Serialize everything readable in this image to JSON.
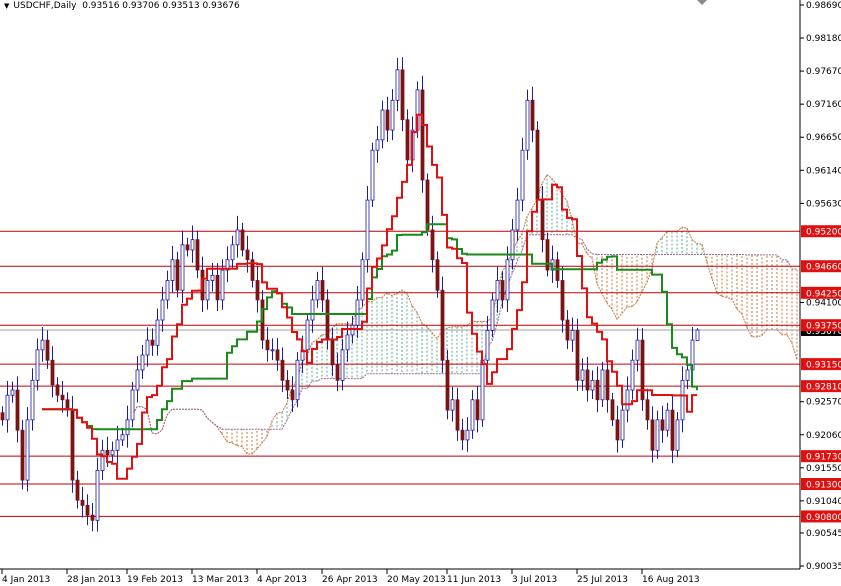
{
  "header": {
    "symbol": "USDCHF,Daily",
    "ohlc_text": "0.93516 0.93706 0.93513 0.93676"
  },
  "chart_data": {
    "type": "candlestick",
    "title": "USDCHF,Daily",
    "ylim": [
      0.90035,
      0.9869
    ],
    "indicator": "Ichimoku Kinko Hyo (9, 26, 52)",
    "first_open": 0.924,
    "last_bar": {
      "open": 0.93516,
      "high": 0.93706,
      "low": 0.93513,
      "close": 0.93676
    },
    "closes": [
      0.9229,
      0.9267,
      0.9275,
      0.9213,
      0.9136,
      0.9229,
      0.929,
      0.9337,
      0.9352,
      0.9321,
      0.9283,
      0.9267,
      0.926,
      0.9244,
      0.9136,
      0.9105,
      0.9097,
      0.9082,
      0.9074,
      0.9151,
      0.9182,
      0.9175,
      0.9182,
      0.9198,
      0.9206,
      0.9229,
      0.9275,
      0.9306,
      0.9329,
      0.9352,
      0.9344,
      0.9383,
      0.9414,
      0.9444,
      0.9476,
      0.9429,
      0.9499,
      0.9491,
      0.9507,
      0.946,
      0.9414,
      0.9444,
      0.9452,
      0.9414,
      0.946,
      0.9476,
      0.9499,
      0.9522,
      0.9491,
      0.9476,
      0.9444,
      0.9414,
      0.9352,
      0.9337,
      0.9337,
      0.9321,
      0.929,
      0.9275,
      0.926,
      0.9321,
      0.9337,
      0.9383,
      0.9414,
      0.9444,
      0.9414,
      0.9352,
      0.9314,
      0.929,
      0.9337,
      0.936,
      0.9375,
      0.9414,
      0.9476,
      0.9568,
      0.9645,
      0.9661,
      0.9707,
      0.9676,
      0.9722,
      0.9769,
      0.9692,
      0.963,
      0.9676,
      0.9738,
      0.9599,
      0.9522,
      0.9476,
      0.9429,
      0.9321,
      0.9244,
      0.926,
      0.9213,
      0.9198,
      0.9213,
      0.926,
      0.9229,
      0.9321,
      0.9367,
      0.9414,
      0.9444,
      0.9414,
      0.9476,
      0.9522,
      0.9568,
      0.9645,
      0.9722,
      0.9676,
      0.9568,
      0.9507,
      0.946,
      0.9476,
      0.9444,
      0.9383,
      0.9352,
      0.9367,
      0.929,
      0.9306,
      0.9275,
      0.929,
      0.926,
      0.9306,
      0.926,
      0.9229,
      0.9198,
      0.9244,
      0.9275,
      0.9321,
      0.9352,
      0.926,
      0.9229,
      0.9182,
      0.9229,
      0.9213,
      0.9244,
      0.9182,
      0.9229,
      0.929,
      0.9306,
      0.9352,
      0.9368
    ],
    "level_lines": [
      0.952,
      0.9466,
      0.9425,
      0.9375,
      0.9315,
      0.9281,
      0.9173,
      0.913,
      0.908
    ],
    "level_labels": [
      "0.95200",
      "0.94660",
      "0.94250",
      "0.93750",
      "0.93150",
      "0.92810",
      "0.91730",
      "0.91300",
      "0.90800"
    ],
    "y_ticks": [
      0.9869,
      0.9818,
      0.9767,
      0.9716,
      0.9665,
      0.9614,
      0.9563,
      0.941,
      0.9257,
      0.9206,
      0.9155,
      0.9104,
      0.90545,
      0.90035
    ],
    "y_tick_labels": [
      "0.98690",
      "0.98180",
      "0.97670",
      "0.97160",
      "0.96650",
      "0.96140",
      "0.95630",
      "0.94100",
      "0.92570",
      "0.92060",
      "0.91550",
      "0.91040",
      "0.90545",
      "0.90035"
    ],
    "current_price": 0.93676,
    "current_price_label": "0.93676",
    "x_ticks": [
      {
        "bar": 0,
        "label": "4 Jan 2013"
      },
      {
        "bar": 13,
        "label": "28 Jan 2013"
      },
      {
        "bar": 25,
        "label": "19 Feb 2013"
      },
      {
        "bar": 38,
        "label": "13 Mar 2013"
      },
      {
        "bar": 51,
        "label": "4 Apr 2013"
      },
      {
        "bar": 64,
        "label": "26 Apr 2013"
      },
      {
        "bar": 77,
        "label": "20 May 2013"
      },
      {
        "bar": 89,
        "label": "11 Jun 2013"
      },
      {
        "bar": 102,
        "label": "3 Jul 2013"
      },
      {
        "bar": 115,
        "label": "25 Jul 2013"
      },
      {
        "bar": 128,
        "label": "16 Aug 2013"
      }
    ],
    "colors": {
      "bull_body": "#ffffff",
      "bear_body": "#7a1414",
      "candle_outline": "#1c1ca0",
      "tenkan": "#e01010",
      "kijun": "#1a8a1a",
      "level": "#c00000",
      "level_label_bg": "#e01010",
      "cloud_bear": "#c8773a",
      "cloud_bull": "#5aa890",
      "current_line": "#a0a0a0"
    }
  }
}
